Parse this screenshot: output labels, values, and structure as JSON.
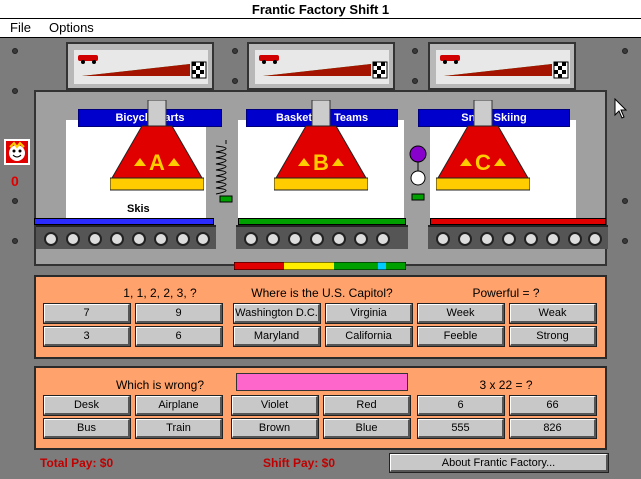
{
  "window": {
    "title": "Frantic Factory Shift 1"
  },
  "menu": {
    "file": "File",
    "options": "Options"
  },
  "score": {
    "value": "0"
  },
  "categories": [
    "Bicycle Parts",
    "Basketball Teams",
    "Snow Skiing"
  ],
  "hoppers": [
    "A",
    "B",
    "C"
  ],
  "conveyor_item": "Skis",
  "colors": {
    "belt_a": "#2b2bff",
    "belt_b": "#00a000",
    "belt_c": "#e00000",
    "panel": "#ffa26b"
  },
  "row1": {
    "questions": [
      "1, 1, 2, 2, 3, ?",
      "Where is the U.S. Capitol?",
      "Powerful = ?"
    ],
    "answers": [
      [
        "7",
        "9",
        "3",
        "6"
      ],
      [
        "Washington D.C.",
        "Virginia",
        "Maryland",
        "California"
      ],
      [
        "Week",
        "Weak",
        "Feeble",
        "Strong"
      ]
    ]
  },
  "row2": {
    "questions": [
      "Which is wrong?",
      "",
      "3 x 22 = ?"
    ],
    "answers": [
      [
        "Desk",
        "Airplane",
        "Bus",
        "Train"
      ],
      [
        "Violet",
        "Red",
        "Brown",
        "Blue"
      ],
      [
        "6",
        "66",
        "555",
        "826"
      ]
    ]
  },
  "footer": {
    "total_pay": "Total Pay: $0",
    "shift_pay": "Shift Pay: $0",
    "about_button": "About Frantic Factory..."
  }
}
